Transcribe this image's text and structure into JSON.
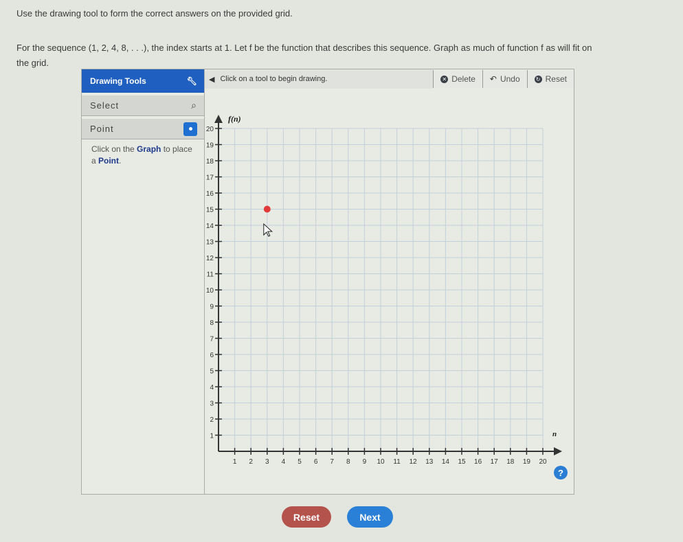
{
  "instructions": {
    "line1": "Use the drawing tool to form the correct answers on the provided grid.",
    "line2": "For the sequence (1, 2, 4, 8, . . .), the index starts at 1. Let f be the function that describes this sequence. Graph as much of function f as will fit on",
    "line3": "the grid."
  },
  "tools": {
    "header": "Drawing Tools",
    "header_icon": "wrench-icon",
    "select_label": "Select",
    "point_label": "Point",
    "hint_pre": "Click on the ",
    "hint_graph": "Graph",
    "hint_mid": " to place a ",
    "hint_point": "Point",
    "hint_end": "."
  },
  "toolbar": {
    "status": "Click on a tool to begin drawing.",
    "delete": "Delete",
    "undo": "Undo",
    "reset": "Reset"
  },
  "chart_data": {
    "type": "scatter",
    "xlabel": "n",
    "ylabel": "f(n)",
    "xlim": [
      0,
      20
    ],
    "ylim": [
      0,
      20
    ],
    "x_ticks": [
      1,
      2,
      3,
      4,
      5,
      6,
      7,
      8,
      9,
      10,
      11,
      12,
      13,
      14,
      15,
      16,
      17,
      18,
      19,
      20
    ],
    "y_ticks": [
      1,
      2,
      3,
      4,
      5,
      6,
      7,
      8,
      9,
      10,
      11,
      12,
      13,
      14,
      15,
      16,
      17,
      18,
      19,
      20
    ],
    "grid": true,
    "points": [
      {
        "x": 3,
        "y": 15
      }
    ],
    "point_color": "#e03a3a"
  },
  "buttons": {
    "reset": "Reset",
    "next": "Next",
    "help": "?"
  },
  "colors": {
    "reset": "#b4534c",
    "next": "#2a80d6",
    "accent": "#1f5fbf"
  }
}
